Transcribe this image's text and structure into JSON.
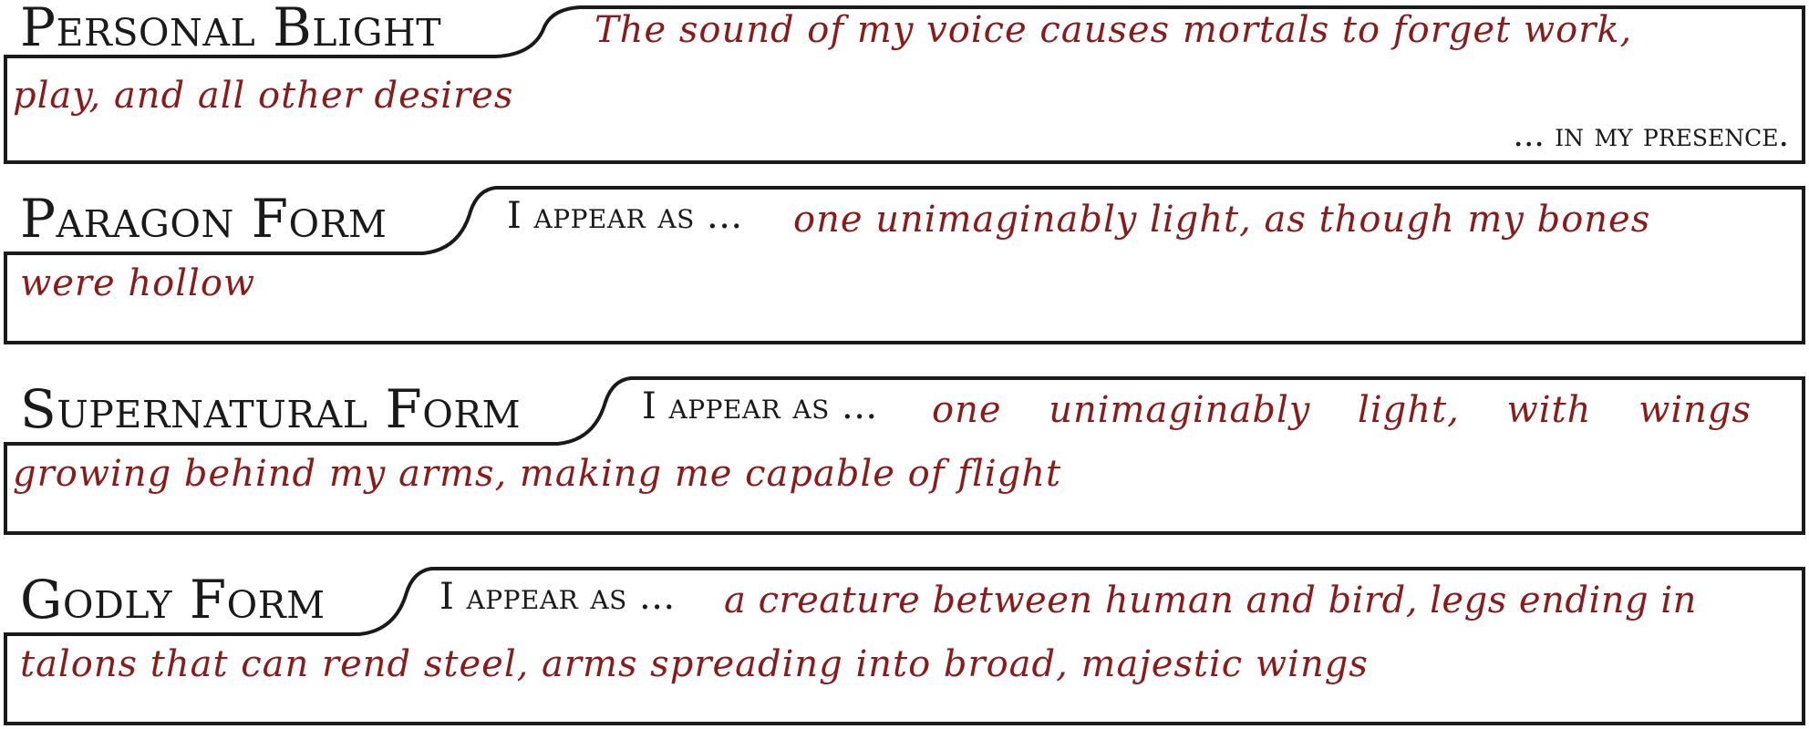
{
  "sections": [
    {
      "title": "Personal Blight",
      "lead": "",
      "text_line1": "The sound of my voice causes mortals to forget work,",
      "text_line2": "play, and all other desires",
      "tail": "... in my presence."
    },
    {
      "title": "Paragon Form",
      "lead": "I appear as ...",
      "text_line1": "one unimaginably light, as though my bones",
      "text_line2": "were hollow",
      "tail": ""
    },
    {
      "title": "Supernatural Form",
      "lead": "I appear as ...",
      "text_line1": "one unimaginably light, with wings",
      "text_line2": "growing behind my arms, making me capable of flight",
      "tail": ""
    },
    {
      "title": "Godly Form",
      "lead": "I appear as ...",
      "text_line1": "a creature between human and bird, legs ending in",
      "text_line2": "talons that can rend steel, arms spreading into broad, majestic wings",
      "tail": ""
    }
  ]
}
